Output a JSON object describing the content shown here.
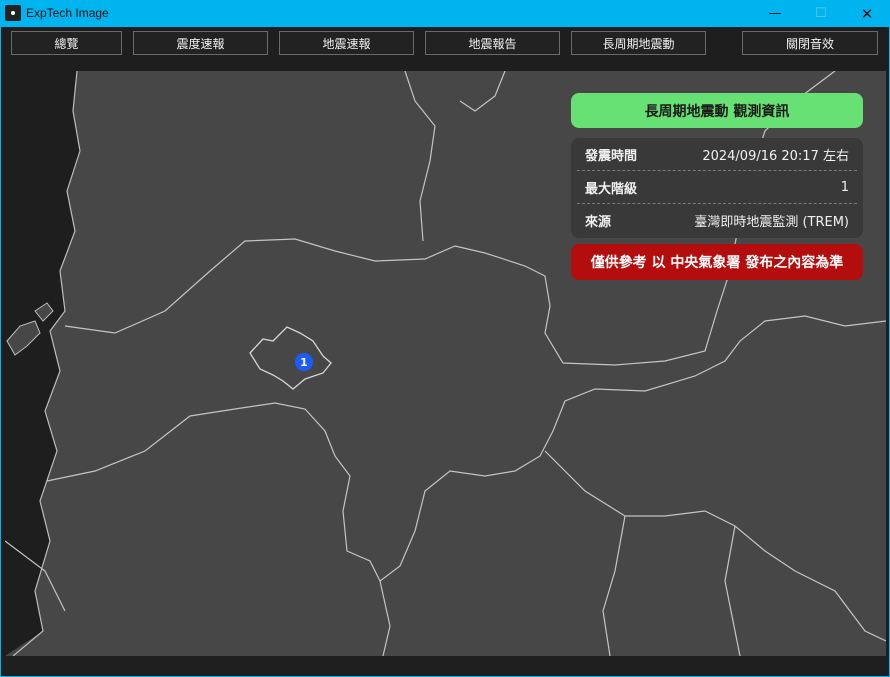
{
  "window": {
    "title": "ExpTech Image",
    "minimize_glyph": "—",
    "maximize_glyph": "☐",
    "close_glyph": "✕"
  },
  "toolbar": {
    "buttons": [
      "總覽",
      "震度速報",
      "地震速報",
      "地震報告",
      "長周期地震動",
      "關閉音效"
    ]
  },
  "info_panel": {
    "header": "長周期地震動 觀測資訊",
    "rows": [
      {
        "key": "發震時間",
        "value": "2024/09/16 20:17 左右"
      },
      {
        "key": "最大階級",
        "value": "1"
      },
      {
        "key": "來源",
        "value": "臺灣即時地震監測 (TREM)"
      }
    ],
    "warning": "僅供參考 以 中央氣象署 發布之內容為準",
    "colors": {
      "header": "#67e173",
      "warning": "#b30d0d"
    }
  },
  "map": {
    "station_marker": {
      "level": "1",
      "color": "#1a5cff"
    }
  }
}
